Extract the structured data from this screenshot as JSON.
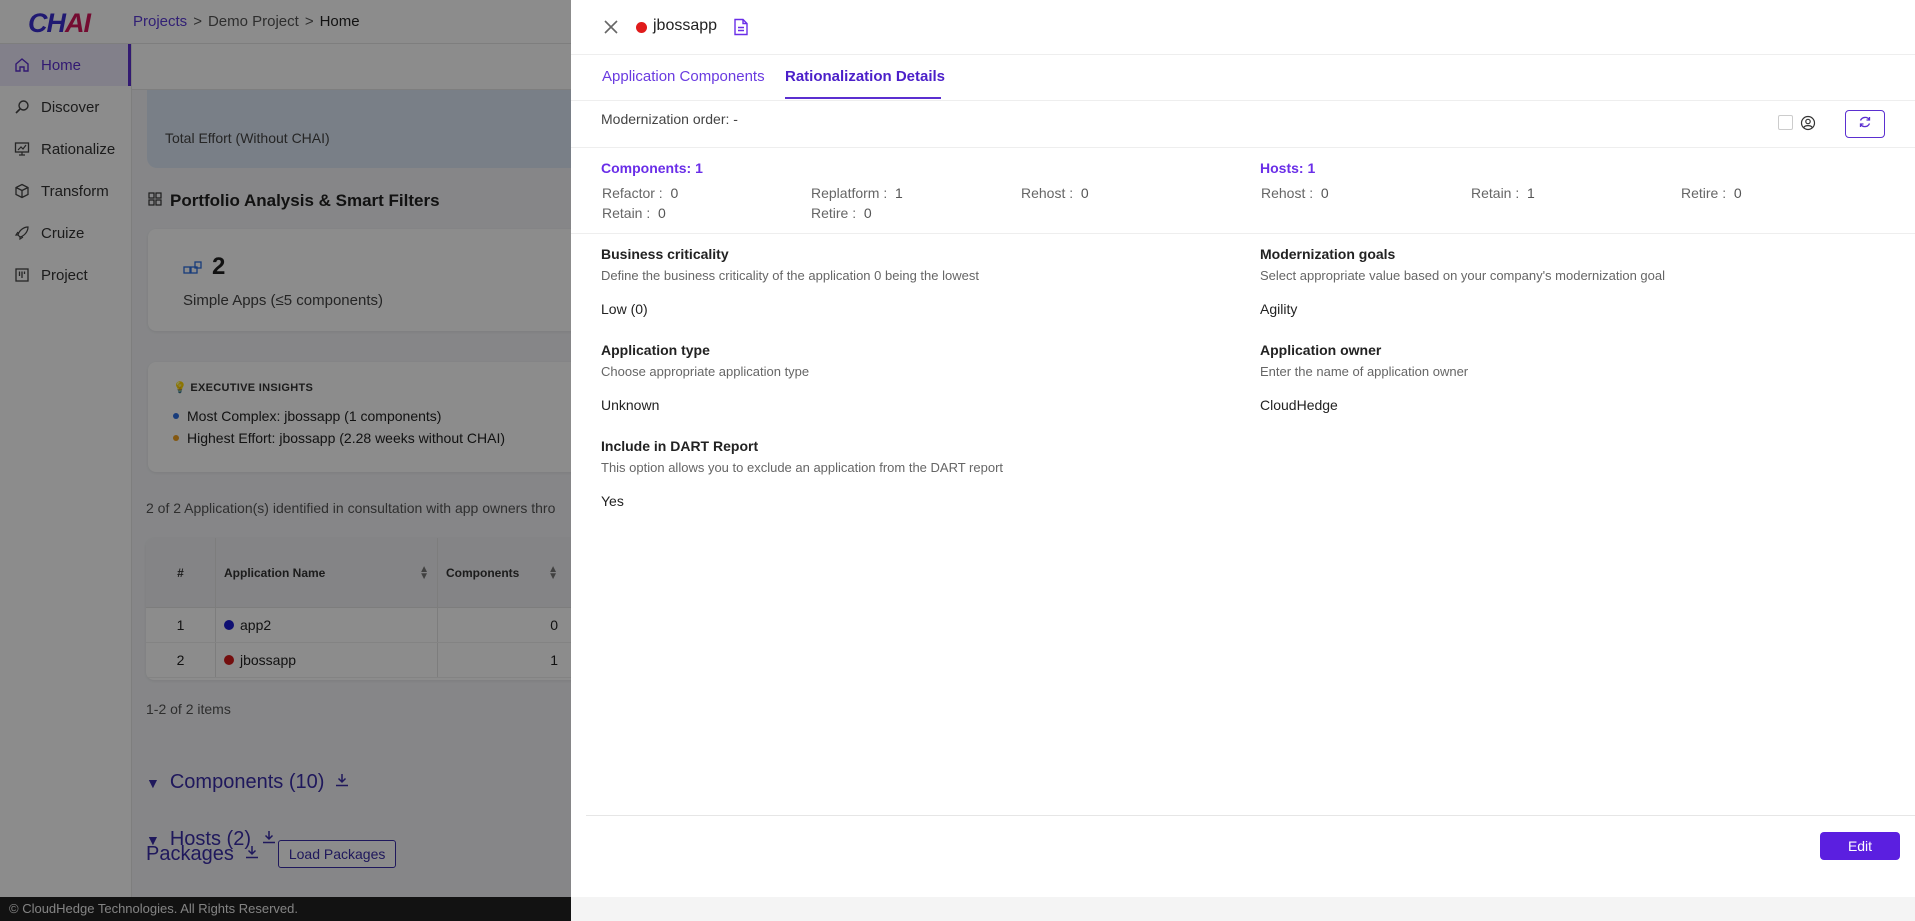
{
  "app": {
    "logo_main": "CH",
    "logo_accent": "AI",
    "breadcrumb": [
      "Projects",
      "Demo Project",
      "Home"
    ],
    "breadcrumb_sep": ">",
    "nav": [
      {
        "label": "Home",
        "icon": "home-icon",
        "active": true
      },
      {
        "label": "Discover",
        "icon": "search-icon"
      },
      {
        "label": "Rationalize",
        "icon": "chart-icon"
      },
      {
        "label": "Transform",
        "icon": "cube-icon"
      },
      {
        "label": "Cruize",
        "icon": "rocket-icon"
      },
      {
        "label": "Project",
        "icon": "board-icon"
      }
    ],
    "effort_label": "Total Effort (Without CHAI)",
    "portfolio_title": "Portfolio Analysis & Smart Filters",
    "simple_apps_count": "2",
    "simple_apps_label": "Simple Apps (≤5 components)",
    "insights_title": "💡 EXECUTIVE INSIGHTS",
    "insights": [
      {
        "text": "Most Complex: jbossapp (1 components)",
        "color": "#2d6ee0"
      },
      {
        "text": "Highest Effort: jbossapp (2.28 weeks without CHAI)",
        "color": "#f0a020"
      }
    ],
    "identified_text": "2 of 2 Application(s) identified in consultation with app owners thro",
    "table": {
      "headers": [
        "#",
        "Application Name",
        "Components"
      ],
      "rows": [
        {
          "num": "1",
          "name": "app2",
          "dot": "#1c1ccf",
          "components": "0"
        },
        {
          "num": "2",
          "name": "jbossapp",
          "dot": "#d41a1a",
          "components": "1"
        }
      ]
    },
    "pager": "1-2 of 2 items",
    "components_section": "Components (10)",
    "hosts_section": "Hosts (2)",
    "packages_label": "Packages",
    "load_packages": "Load Packages",
    "footer": "© CloudHedge Technologies. All Rights Reserved."
  },
  "drawer": {
    "app_name": "jbossapp",
    "app_color": "#e01b1b",
    "tabs": [
      {
        "label": "Application Components",
        "active": false
      },
      {
        "label": "Rationalization Details",
        "active": true
      }
    ],
    "modernization_order": "Modernization order: -",
    "components": {
      "title": "Components: 1",
      "items": [
        {
          "label": "Refactor",
          "value": "0"
        },
        {
          "label": "Replatform",
          "value": "1"
        },
        {
          "label": "Rehost",
          "value": "0"
        },
        {
          "label": "Retain",
          "value": "0"
        },
        {
          "label": "Retire",
          "value": "0"
        }
      ]
    },
    "hosts": {
      "title": "Hosts: 1",
      "items": [
        {
          "label": "Rehost",
          "value": "0"
        },
        {
          "label": "Retain",
          "value": "1"
        },
        {
          "label": "Retire",
          "value": "0"
        }
      ]
    },
    "fields": {
      "business_criticality": {
        "title": "Business criticality",
        "desc": "Define the business criticality of the application 0 being the lowest",
        "value": "Low (0)"
      },
      "modernization_goals": {
        "title": "Modernization goals",
        "desc": "Select appropriate value based on your company's modernization goal",
        "value": "Agility"
      },
      "application_type": {
        "title": "Application type",
        "desc": "Choose appropriate application type",
        "value": "Unknown"
      },
      "application_owner": {
        "title": "Application owner",
        "desc": "Enter the name of application owner",
        "value": "CloudHedge"
      },
      "include_dart": {
        "title": "Include in DART Report",
        "desc": "This option allows you to exclude an application from the DART report",
        "value": "Yes"
      }
    },
    "edit_label": "Edit",
    "accent_color": "#5b1fe0"
  }
}
